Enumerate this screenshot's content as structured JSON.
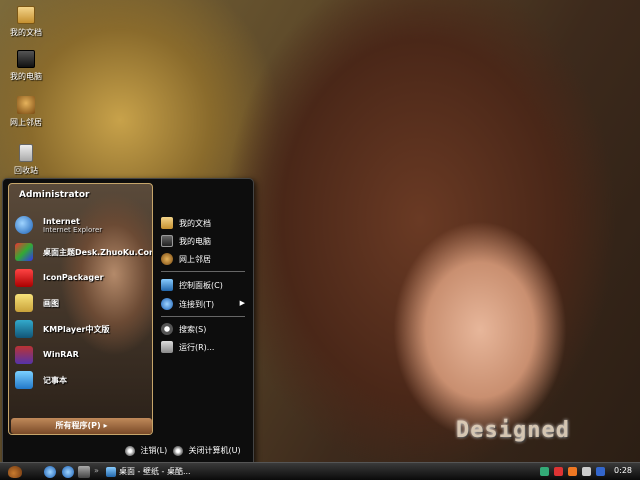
{
  "desktop": {
    "icons": [
      {
        "label": "我的文档",
        "icon": "folder-documents-icon"
      },
      {
        "label": "我的电脑",
        "icon": "computer-icon"
      },
      {
        "label": "网上邻居",
        "icon": "network-icon"
      },
      {
        "label": "回收站",
        "icon": "recycle-bin-icon"
      }
    ],
    "watermark": "Designed"
  },
  "start_menu": {
    "user": "Administrator",
    "programs": [
      {
        "name": "Internet",
        "sub": "Internet Explorer",
        "icon": "internet-explorer-icon"
      },
      {
        "name": "桌面主题Desk.ZhuoKu.Com",
        "sub": "",
        "icon": "theme-icon"
      },
      {
        "name": "IconPackager",
        "sub": "",
        "icon": "iconpackager-icon"
      },
      {
        "name": "画图",
        "sub": "",
        "icon": "paint-icon"
      },
      {
        "name": "KMPlayer中文版",
        "sub": "",
        "icon": "kmplayer-icon"
      },
      {
        "name": "WinRAR",
        "sub": "",
        "icon": "winrar-icon"
      },
      {
        "name": "记事本",
        "sub": "",
        "icon": "notepad-icon"
      }
    ],
    "all_programs": "所有程序(P)",
    "right_items": [
      {
        "label": "我的文档",
        "icon": "documents-icon"
      },
      {
        "label": "我的电脑",
        "icon": "computer-icon"
      },
      {
        "label": "网上邻居",
        "icon": "network-icon"
      },
      {
        "label": "控制面板(C)",
        "icon": "control-panel-icon"
      },
      {
        "label": "连接到(T)",
        "icon": "connect-icon"
      },
      {
        "label": "搜索(S)",
        "icon": "search-icon"
      },
      {
        "label": "运行(R)...",
        "icon": "run-icon"
      }
    ],
    "logoff": "注销(L)",
    "shutdown": "关闭计算机(U)"
  },
  "taskbar": {
    "task_title": "桌面 - 壁纸 - 桌酷...",
    "clock": "0:28"
  }
}
